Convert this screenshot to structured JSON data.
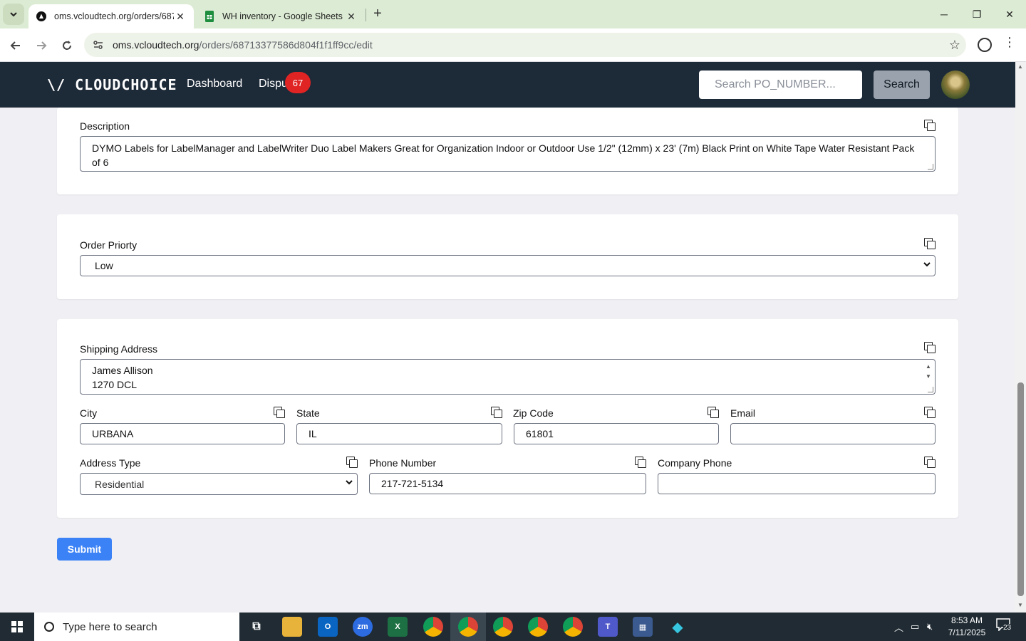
{
  "browser": {
    "tabs": [
      {
        "title": "oms.vcloudtech.org/orders/687",
        "active": true
      },
      {
        "title": "WH inventory - Google Sheets",
        "active": false
      }
    ],
    "url_domain": "oms.vcloudtech.org",
    "url_path": "/orders/68713377586d804f1f1ff9cc/edit"
  },
  "header": {
    "logo": "\\/ CLOUDCHOICE",
    "nav": [
      {
        "label": "Dashboard"
      },
      {
        "label": "Dispu"
      }
    ],
    "dispute_badge": "67",
    "search_placeholder": "Search PO_NUMBER...",
    "search_button": "Search"
  },
  "form": {
    "description": {
      "label": "Description",
      "value": "DYMO Labels for LabelManager and LabelWriter Duo Label Makers Great for Organization Indoor or Outdoor Use 1/2\" (12mm) x 23' (7m) Black Print on White Tape Water Resistant Pack of 6"
    },
    "order_priority": {
      "label": "Order Priorty",
      "value": "Low"
    },
    "shipping_address": {
      "label": "Shipping Address",
      "line1": "James Allison",
      "line2": "1270 DCL"
    },
    "city": {
      "label": "City",
      "value": "URBANA"
    },
    "state": {
      "label": "State",
      "value": "IL"
    },
    "zip": {
      "label": "Zip Code",
      "value": "61801"
    },
    "email": {
      "label": "Email",
      "value": ""
    },
    "address_type": {
      "label": "Address Type",
      "value": "Residential"
    },
    "phone": {
      "label": "Phone Number",
      "value": "217-721-5134"
    },
    "company_phone": {
      "label": "Company Phone",
      "value": ""
    },
    "submit_label": "Submit"
  },
  "taskbar": {
    "search_placeholder": "Type here to search",
    "time": "8:53 AM",
    "date": "7/11/2025",
    "notification_count": "23"
  }
}
